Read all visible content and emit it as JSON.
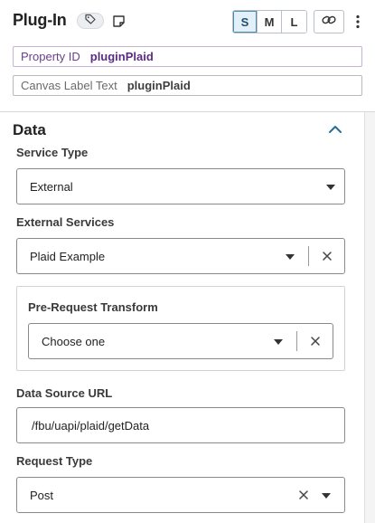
{
  "header": {
    "title": "Plug-In",
    "size_buttons": [
      "S",
      "M",
      "L"
    ],
    "active_size": "S",
    "icons": {
      "tag": "tag-icon",
      "note": "note-icon",
      "link": "link-icon",
      "menu": "more-vertical-icon"
    }
  },
  "properties": {
    "property_id": {
      "label": "Property ID",
      "value": "pluginPlaid"
    },
    "canvas_label": {
      "label": "Canvas Label Text",
      "value": "pluginPlaid"
    }
  },
  "data_section": {
    "title": "Data",
    "service_type": {
      "label": "Service Type",
      "value": "External"
    },
    "external_services": {
      "label": "External Services",
      "value": "Plaid Example"
    },
    "pre_request_transform": {
      "label": "Pre-Request Transform",
      "placeholder": "Choose one"
    },
    "data_source_url": {
      "label": "Data Source URL",
      "value": "/fbu/uapi/plaid/getData"
    },
    "request_type": {
      "label": "Request Type",
      "value": "Post"
    }
  },
  "colors": {
    "accent_purple": "#5b2c84",
    "active_size_bg": "#e4f0f7",
    "chevron_blue": "#2a6d93"
  }
}
